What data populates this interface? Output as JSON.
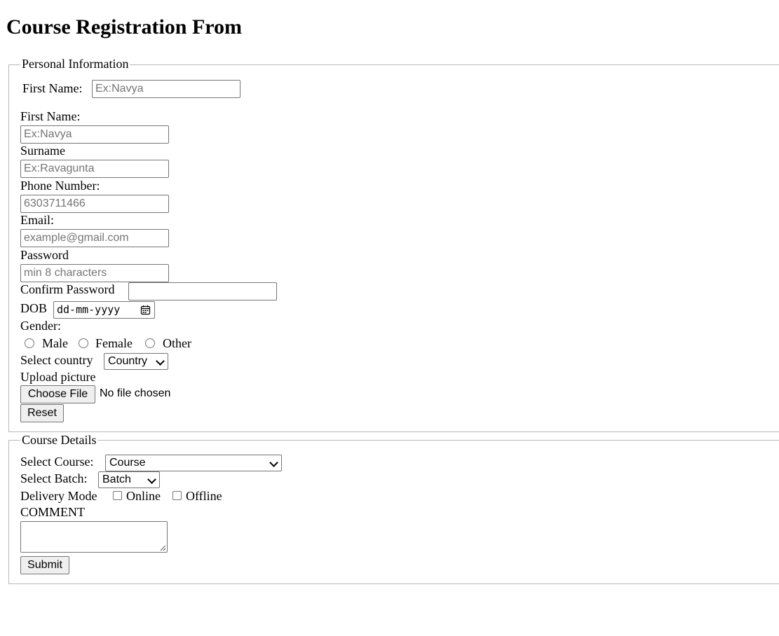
{
  "title": "Course Registration From",
  "personal": {
    "legend": "Personal Information",
    "first_name_inline_label": "First Name:",
    "first_name_inline_placeholder": "Ex:Navya",
    "first_name_label": "First Name:",
    "first_name_placeholder": "Ex:Navya",
    "surname_label": "Surname",
    "surname_placeholder": "Ex:Ravagunta",
    "phone_label": "Phone Number:",
    "phone_placeholder": "6303711466",
    "email_label": "Email:",
    "email_placeholder": "example@gmail.com",
    "password_label": "Password",
    "password_placeholder": "min 8 characters",
    "confirm_password_label": "Confirm Password",
    "dob_label": "DOB",
    "dob_placeholder": "dd-mm-yyyy",
    "gender_label": "Gender:",
    "gender_options": [
      "Male",
      "Female",
      "Other"
    ],
    "country_label": "Select country",
    "country_selected": "Country",
    "upload_label": "Upload picture",
    "choose_file_button": "Choose File",
    "no_file_text": "No file chosen",
    "reset_button": "Reset"
  },
  "course": {
    "legend": "Course Details",
    "course_label": "Select Course:",
    "course_selected": "Course",
    "batch_label": "Select Batch:",
    "batch_selected": "Batch",
    "delivery_label": "Delivery Mode",
    "delivery_options": [
      "Online",
      "Offline"
    ],
    "comment_label": "COMMENT",
    "submit_button": "Submit"
  },
  "icons": {
    "calendar": "calendar-icon",
    "dropdown": "chevron-down-icon"
  }
}
